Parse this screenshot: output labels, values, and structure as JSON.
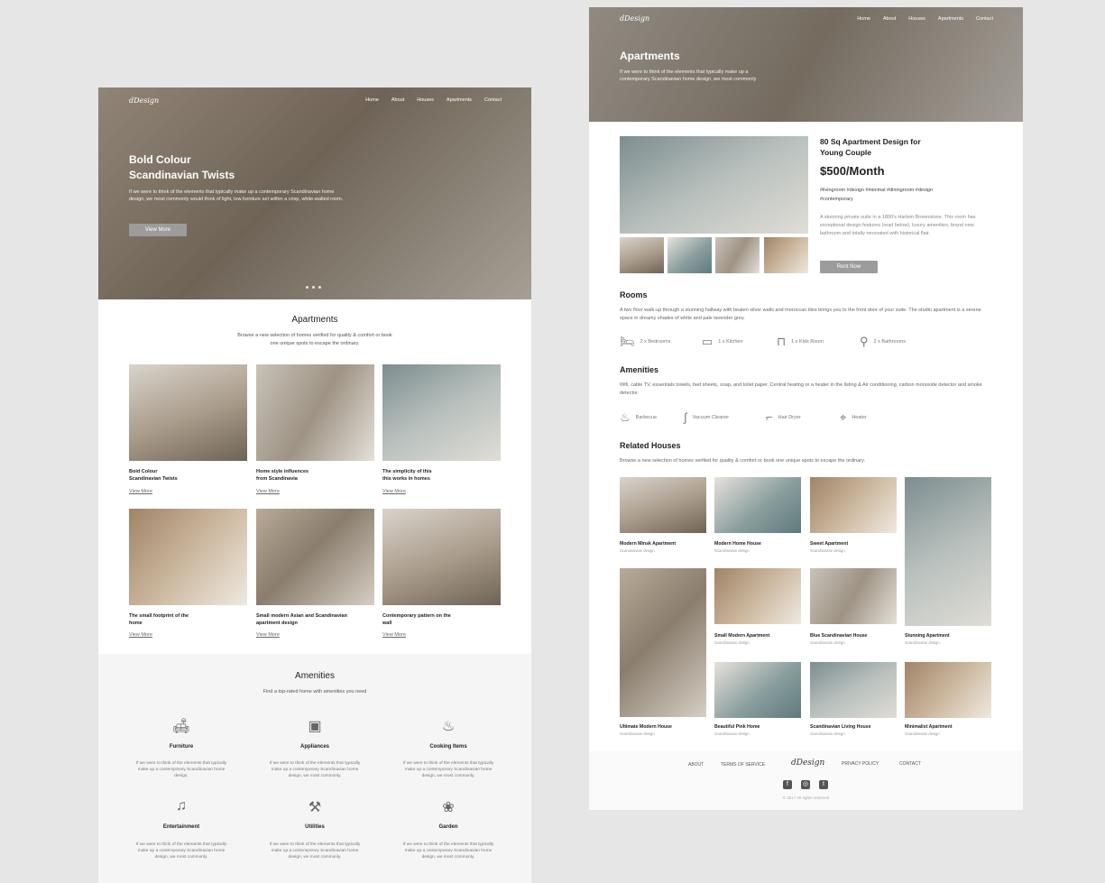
{
  "left": {
    "logo": "dDesign",
    "nav": [
      "Home",
      "About",
      "Houses",
      "Apartments",
      "Contact"
    ],
    "hero": {
      "title_line1": "Bold Colour",
      "title_line2": "Scandinavian Twists",
      "text": "If we were to think of the elements that typically make up a contemporary Scandinavian home design, we most commonly would think of light, low furniture set within a crisp, white-walled room.",
      "button": "View More"
    },
    "apartments": {
      "title": "Apartments",
      "subtitle_line1": "Browse a new selection of homes verified for quality & comfort or book",
      "subtitle_line2": "one unique spots to escape the ordinary.",
      "cards": [
        {
          "title": "Bold Colour\nScandinavian Twists",
          "link": "View More"
        },
        {
          "title": "Home style influences\nfrom Scandinavia",
          "link": "View More"
        },
        {
          "title": "The simplicity of this\nthis works in homes",
          "link": "View More"
        },
        {
          "title": "The small footprint of the\nhome",
          "link": "View More"
        },
        {
          "title": "Small modern Asian and Scandinavian\napartment design",
          "link": "View More"
        },
        {
          "title": "Contemporary pattern on the\nwall",
          "link": "View More"
        }
      ]
    },
    "amenities": {
      "title": "Amenities",
      "subtitle": "Find a top-rated home with amenities you need",
      "items": [
        {
          "icon": "sofa-icon",
          "glyph": "🛋",
          "name": "Furniture",
          "desc": "If we were to think of the elements that typically make up a contemporary Scandinavian home design."
        },
        {
          "icon": "appliance-icon",
          "glyph": "▣",
          "name": "Appliances",
          "desc": "If we were to think of the elements that typically make up a contemporary Scandinavian home design, we most commonly."
        },
        {
          "icon": "cooking-pot-icon",
          "glyph": "♨",
          "name": "Cooking Items",
          "desc": "If we were to think of the elements that typically make up a contemporary Scandinavian home design, we most commonly."
        },
        {
          "icon": "entertainment-icon",
          "glyph": "♫",
          "name": "Entertainment",
          "desc": "If we were to think of the elements that typically make up a contemporary Scandinavian home design, we most commonly."
        },
        {
          "icon": "hammer-icon",
          "glyph": "⚒",
          "name": "Utilities",
          "desc": "If we were to think of the elements that typically make up a contemporary Scandinavian home design, we most commonly."
        },
        {
          "icon": "garden-icon",
          "glyph": "❀",
          "name": "Garden",
          "desc": "If we were to think of the elements that typically make up a contemporary Scandinavian home design, we most commonly."
        }
      ]
    }
  },
  "right": {
    "logo": "dDesign",
    "nav": [
      "Home",
      "About",
      "Houses",
      "Apartments",
      "Contact"
    ],
    "hero": {
      "title": "Apartments",
      "text_line1": "If we were to think of the elements that typically make up a",
      "text_line2": "contemporary Scandinavian home design, we most commonly"
    },
    "listing": {
      "title_line1": "80 Sq Apartment Design for",
      "title_line2": "Young Couple",
      "price": "$500/Month",
      "tags_line1": "#livingroom #design #minimal #diningroom #design",
      "tags_line2": "#contemporary",
      "desc": "A stunning private suite in a 1800's Harlem Brownstone. This room has exceptional design features (read below), luxury amenities, brand new bathroom and totally renovated with historical flair.",
      "button": "Rent Now"
    },
    "rooms": {
      "title": "Rooms",
      "text": "A two floor walk-up through a stunning hallway with beaten silver walls and moroccan tiles brings you to the front door of your suite. The studio apartment is a serene space in dreamy shades of white and pale lavender grey.",
      "features": [
        {
          "icon": "bed-icon",
          "glyph": "🛏",
          "label": "2 x Bedrooms"
        },
        {
          "icon": "kitchen-icon",
          "glyph": "▭",
          "label": "1 x Kitchen"
        },
        {
          "icon": "kids-bed-icon",
          "glyph": "⊓",
          "label": "1 x Kids Room"
        },
        {
          "icon": "shower-icon",
          "glyph": "⚲",
          "label": "2 x Bathrooms"
        }
      ]
    },
    "amenities": {
      "title": "Amenities",
      "text": "Wifi, cable TV, essentials towels, bed sheets, soap, and toilet paper. Central heating or a heater in the listing & Air conditioning, carbon monoxide detector and smoke detector.",
      "features": [
        {
          "icon": "barbecue-icon",
          "glyph": "♨",
          "label": "Barbecue"
        },
        {
          "icon": "vacuum-icon",
          "glyph": "∫",
          "label": "Vacuum Cleaner"
        },
        {
          "icon": "hair-dryer-icon",
          "glyph": "⌐",
          "label": "Hair Dryer"
        },
        {
          "icon": "heater-icon",
          "glyph": "⌖",
          "label": "Heater"
        }
      ]
    },
    "related": {
      "title": "Related Houses",
      "subtitle": "Browse a new selection of homes verified for quality & comfort or book one unique spots to escape the ordinary.",
      "items": [
        {
          "title": "Modern Minsk Apartment",
          "sub": "Scandinavian design"
        },
        {
          "title": "Modern Home House",
          "sub": "Scandinavian design"
        },
        {
          "title": "Sweet Apartment",
          "sub": "Scandinavian design"
        },
        {
          "title": "Small Modern Apartment",
          "sub": "Scandinavian design"
        },
        {
          "title": "Blue Scandinavian House",
          "sub": "Scandinavian design"
        },
        {
          "title": "Stunning Apartment",
          "sub": "Scandinavian design"
        },
        {
          "title": "Ultimate Modern House",
          "sub": "Scandinavian design"
        },
        {
          "title": "Beautiful Pink Home",
          "sub": "Scandinavian design"
        },
        {
          "title": "Scandinavian Living House",
          "sub": "Scandinavian design"
        },
        {
          "title": "Minimalist Apartment",
          "sub": "Scandinavian design"
        }
      ]
    },
    "footer": {
      "links": [
        "ABOUT",
        "TERMS OF SERVICE",
        "PRIVACY POLICY",
        "CONTACT"
      ],
      "logo": "dDesign",
      "social": [
        {
          "icon": "facebook-icon",
          "glyph": "f"
        },
        {
          "icon": "instagram-icon",
          "glyph": "◎"
        },
        {
          "icon": "twitter-icon",
          "glyph": "t"
        }
      ],
      "copyright": "© 2017 All rights reserved"
    }
  }
}
